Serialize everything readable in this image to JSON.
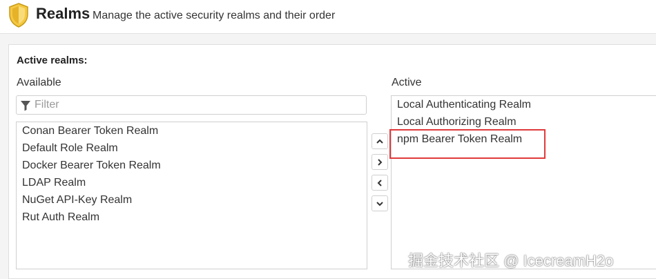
{
  "header": {
    "title": "Realms",
    "subtitle": "Manage the active security realms and their order",
    "icon": "shield-icon"
  },
  "section": {
    "label": "Active realms:"
  },
  "available": {
    "label": "Available",
    "filter_placeholder": "Filter",
    "filter_value": "",
    "items": [
      "Conan Bearer Token Realm",
      "Default Role Realm",
      "Docker Bearer Token Realm",
      "LDAP Realm",
      "NuGet API-Key Realm",
      "Rut Auth Realm"
    ]
  },
  "active": {
    "label": "Active",
    "items": [
      "Local Authenticating Realm",
      "Local Authorizing Realm",
      "npm Bearer Token Realm"
    ],
    "highlighted_item": "npm Bearer Token Realm",
    "highlight_color": "#e0393b"
  },
  "buttons": {
    "move_up": "chevron-up-icon",
    "move_right": "chevron-right-icon",
    "move_left": "chevron-left-icon",
    "move_down": "chevron-down-icon"
  },
  "watermark": "掘金技术社区 @ IcecreamH2o",
  "colors": {
    "shield_fill": "#f5c842",
    "shield_border": "#c79a16",
    "highlight": "#e0393b"
  }
}
